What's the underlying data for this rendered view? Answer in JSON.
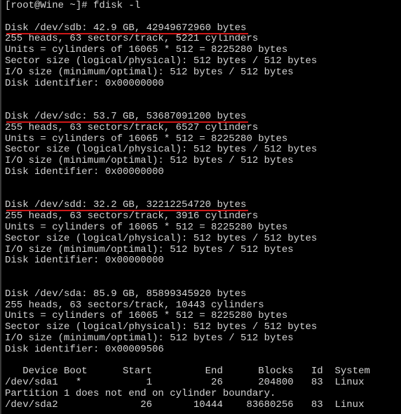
{
  "terminal": {
    "lines": [
      "[root@Wine ~]# fdisk -l",
      "",
      "Disk /dev/sdb: 42.9 GB, 42949672960 bytes",
      "255 heads, 63 sectors/track, 5221 cylinders",
      "Units = cylinders of 16065 * 512 = 8225280 bytes",
      "Sector size (logical/physical): 512 bytes / 512 bytes",
      "I/O size (minimum/optimal): 512 bytes / 512 bytes",
      "Disk identifier: 0x00000000",
      "",
      "",
      "Disk /dev/sdc: 53.7 GB, 53687091200 bytes",
      "255 heads, 63 sectors/track, 6527 cylinders",
      "Units = cylinders of 16065 * 512 = 8225280 bytes",
      "Sector size (logical/physical): 512 bytes / 512 bytes",
      "I/O size (minimum/optimal): 512 bytes / 512 bytes",
      "Disk identifier: 0x00000000",
      "",
      "",
      "Disk /dev/sdd: 32.2 GB, 32212254720 bytes",
      "255 heads, 63 sectors/track, 3916 cylinders",
      "Units = cylinders of 16065 * 512 = 8225280 bytes",
      "Sector size (logical/physical): 512 bytes / 512 bytes",
      "I/O size (minimum/optimal): 512 bytes / 512 bytes",
      "Disk identifier: 0x00000000",
      "",
      "",
      "Disk /dev/sda: 85.9 GB, 85899345920 bytes",
      "255 heads, 63 sectors/track, 10443 cylinders",
      "Units = cylinders of 16065 * 512 = 8225280 bytes",
      "Sector size (logical/physical): 512 bytes / 512 bytes",
      "I/O size (minimum/optimal): 512 bytes / 512 bytes",
      "Disk identifier: 0x00009506",
      "",
      "   Device Boot      Start         End      Blocks   Id  System",
      "/dev/sda1   *           1          26      204800   83  Linux",
      "Partition 1 does not end on cylinder boundary.",
      "/dev/sda2              26       10444    83680256   83  Linux"
    ],
    "highlighted_lines": [
      2,
      10,
      18
    ],
    "colors": {
      "background": "#000000",
      "text": "#d4d4d4",
      "underline": "#d01818"
    }
  }
}
